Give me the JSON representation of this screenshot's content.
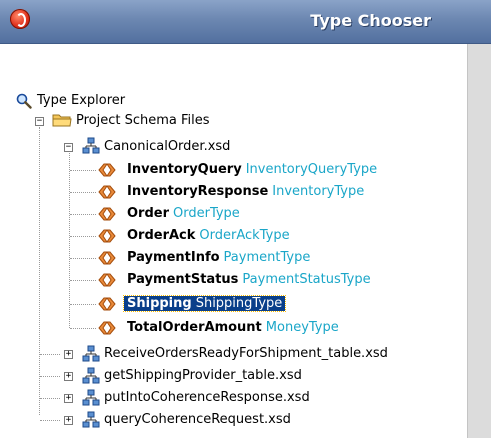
{
  "window": {
    "title": "Type Chooser"
  },
  "tree": {
    "root_label": "Type Explorer",
    "folder_label": "Project Schema Files",
    "schema_open": {
      "label": "CanonicalOrder.xsd",
      "elements": [
        {
          "name": "InventoryQuery",
          "type": "InventoryQueryType"
        },
        {
          "name": "InventoryResponse",
          "type": "InventoryType"
        },
        {
          "name": "Order",
          "type": "OrderType"
        },
        {
          "name": "OrderAck",
          "type": "OrderAckType"
        },
        {
          "name": "PaymentInfo",
          "type": "PaymentType"
        },
        {
          "name": "PaymentStatus",
          "type": "PaymentStatusType"
        },
        {
          "name": "Shipping",
          "type": "ShippingType"
        },
        {
          "name": "TotalOrderAmount",
          "type": "MoneyType"
        }
      ]
    },
    "schemas_closed": [
      {
        "label": "ReceiveOrdersReadyForShipment_table.xsd"
      },
      {
        "label": "getShippingProvider_table.xsd"
      },
      {
        "label": "putIntoCoherenceResponse.xsd"
      },
      {
        "label": "queryCoherenceRequest.xsd"
      }
    ],
    "expander_collapse": "−",
    "expander_expand": "+"
  },
  "colors": {
    "type_text": "#1aa6c8",
    "selection_bg": "#0a3f8a",
    "title_bar": "#6c87b1"
  }
}
